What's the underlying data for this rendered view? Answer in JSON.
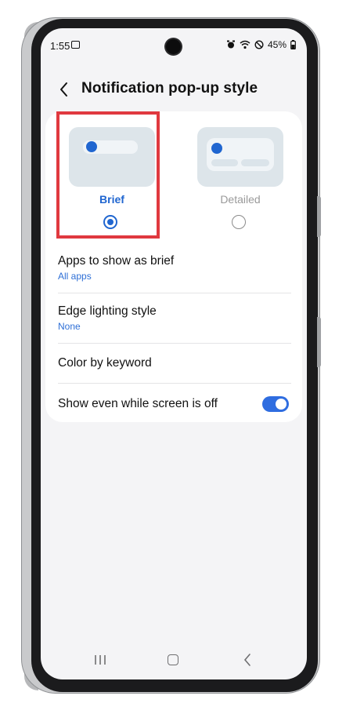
{
  "status_bar": {
    "time": "1:55",
    "battery": "45%",
    "icons": [
      "image-icon",
      "alarm-icon",
      "wifi-icon",
      "dnd-icon",
      "battery-icon"
    ]
  },
  "header": {
    "title": "Notification pop-up style",
    "back_icon": "back-chevron-icon"
  },
  "styles": [
    {
      "label": "Brief",
      "selected": true
    },
    {
      "label": "Detailed",
      "selected": false
    }
  ],
  "settings": [
    {
      "title": "Apps to show as brief",
      "subtitle": "All apps"
    },
    {
      "title": "Edge lighting style",
      "subtitle": "None"
    },
    {
      "title": "Color by keyword"
    },
    {
      "title": "Show even while screen is off",
      "toggle_on": true
    }
  ],
  "colors": {
    "accent": "#2066d0",
    "highlight_border": "#e0393f",
    "subtitle_blue": "#2e6fd6",
    "screen_bg": "#f4f4f6"
  },
  "navbar": {
    "icons": [
      "recents-icon",
      "home-icon",
      "back-icon"
    ]
  }
}
